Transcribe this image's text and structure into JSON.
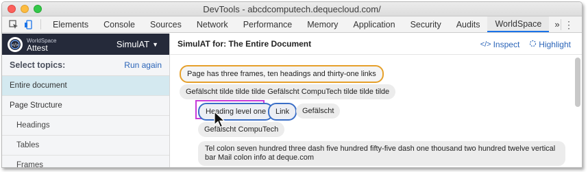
{
  "window": {
    "title": "DevTools - abcdcomputech.dequecloud.com/"
  },
  "devtools_tabs": [
    "Elements",
    "Console",
    "Sources",
    "Network",
    "Performance",
    "Memory",
    "Application",
    "Security",
    "Audits",
    "WorldSpace"
  ],
  "active_tab": "WorldSpace",
  "more_tabs_label": "»",
  "kebab_label": "⋮",
  "brand": {
    "line1": "WorldSpace",
    "line2": "Attest",
    "menu_label": "SimulAT",
    "caret": "▼"
  },
  "sidebar": {
    "heading": "Select topics:",
    "run_again": "Run again",
    "items": [
      {
        "label": "Entire document",
        "selected": true,
        "indent": false
      },
      {
        "label": "Page Structure",
        "selected": false,
        "indent": false
      },
      {
        "label": "Headings",
        "selected": false,
        "indent": true
      },
      {
        "label": "Tables",
        "selected": false,
        "indent": true
      },
      {
        "label": "Frames",
        "selected": false,
        "indent": true
      }
    ]
  },
  "main": {
    "title": "SimulAT for: The Entire Document",
    "inspect_label": "Inspect",
    "highlight_label": "Highlight",
    "chips": {
      "summary": "Page has three frames, ten headings and thirty-one links",
      "line2": "Gefälscht tilde tilde tilde Gefälscht CompuTech tilde tilde tilde",
      "heading": "Heading level one",
      "link": "Link",
      "gefalscht": "Gefälscht",
      "computech": "Gefälscht CompuTech",
      "tel": "Tel colon seven hundred three dash five hundred fifty-five dash one thousand two hundred twelve vertical bar Mail colon info at deque.com"
    }
  },
  "colors": {
    "accent_blue": "#2a64b8",
    "tab_active_underline": "#1a73e8",
    "brand_bg": "#252a3a",
    "selected_bg": "#d4e9f0",
    "orange_outline": "#e6a02a",
    "blue_outline": "#3a6ec7",
    "highlight_magenta": "#c63ad8"
  }
}
